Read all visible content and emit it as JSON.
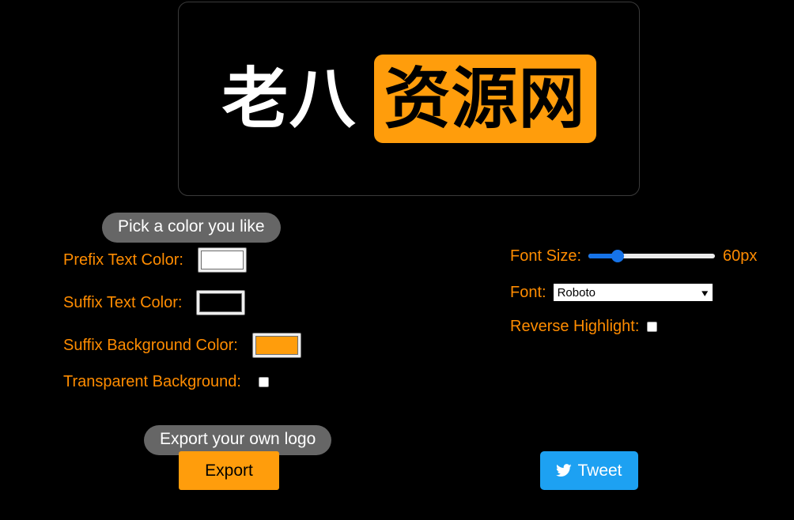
{
  "preview": {
    "prefix_text": "老八",
    "suffix_text": "资源网",
    "prefix_color": "#FFFFFF",
    "suffix_color": "#000000",
    "suffix_background": "#FF9D0C",
    "canvas_background": "#000000"
  },
  "tooltips": {
    "pick_color": "Pick a color you like",
    "export_logo": "Export your own logo"
  },
  "controls_left": [
    {
      "label": "Prefix Text Color:",
      "value": "#FFFFFF"
    },
    {
      "label": "Suffix Text Color:",
      "value": "#000000"
    },
    {
      "label": "Suffix Background Color:",
      "value": "#FF9D0C"
    },
    {
      "label": "Transparent Background:",
      "checked": false
    }
  ],
  "controls_right": {
    "font_size": {
      "label": "Font Size:",
      "value": "60px",
      "slider_percent": 20
    },
    "font": {
      "label": "Font:",
      "selected": "Roboto"
    },
    "reverse_highlight": {
      "label": "Reverse Highlight:",
      "checked": false
    }
  },
  "actions": {
    "export_label": "Export",
    "tweet_label": "Tweet"
  },
  "colors": {
    "accent_orange": "#FF8C00",
    "button_orange": "#FF9D0C",
    "twitter_blue": "#1DA1F2",
    "slider_blue": "#1673E8",
    "pill_gray": "#666666",
    "page_background": "#000000"
  }
}
